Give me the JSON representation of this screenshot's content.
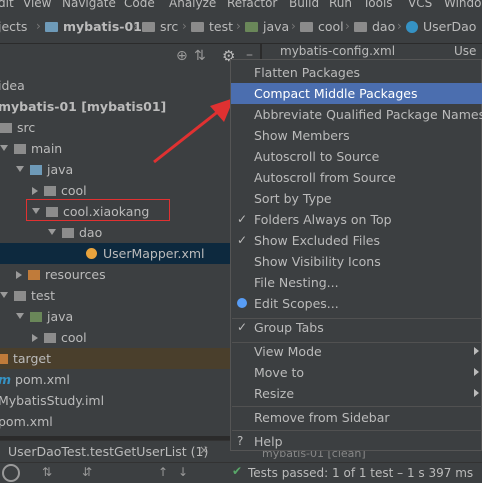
{
  "menubar": [
    "dit",
    "View",
    "Navigate",
    "Code",
    "Analyze",
    "Refactor",
    "Build",
    "Run",
    "Tools",
    "VCS",
    "Windo"
  ],
  "breadcrumb": [
    "jects",
    "mybatis-01",
    "src",
    "test",
    "java",
    "cool",
    "dao",
    "UserDao"
  ],
  "tabs": [
    "mybatis-config.xml",
    "Use"
  ],
  "tree": {
    "items": [
      "idea",
      "mybatis-01 [mybatis01]",
      "src",
      "main",
      "java",
      "cool",
      "cool.xiaokang",
      "dao",
      "UserMapper.xml",
      "resources",
      "test",
      "java",
      "cool",
      "target",
      "pom.xml",
      "MybatisStudy.iml",
      "pom.xml"
    ]
  },
  "menu": {
    "items": [
      "Flatten Packages",
      "Compact Middle Packages",
      "Abbreviate Qualified Package Names",
      "Show Members",
      "Autoscroll to Source",
      "Autoscroll from Source",
      "Sort by Type",
      "Folders Always on Top",
      "Show Excluded Files",
      "Show Visibility Icons",
      "File Nesting...",
      "Edit Scopes...",
      "Group Tabs",
      "View Mode",
      "Move to",
      "Resize",
      "Remove from Sidebar",
      "Help"
    ]
  },
  "run": {
    "title": "UserDaoTest.testGetUserList (1)",
    "status": "Tests passed: 1 of 1 test – 1 s 397 ms",
    "behind": "mybatis-01 [clean]"
  }
}
